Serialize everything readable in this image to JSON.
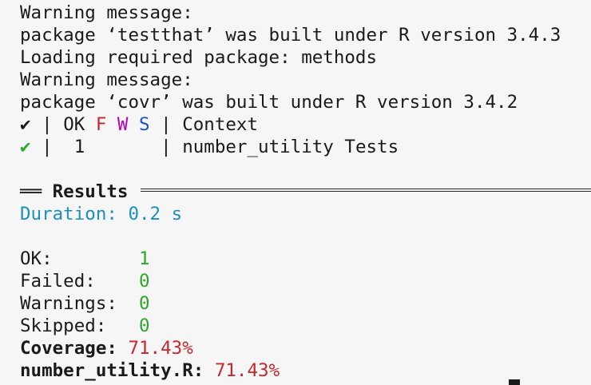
{
  "lines": {
    "warn1_label": "Warning message:",
    "warn1_text": "package ‘testthat’ was built under R version 3.4.3",
    "loading": "Loading required package: methods",
    "warn2_label": "Warning message:",
    "warn2_text": "package ‘covr’ was built under R version 3.4.2"
  },
  "table": {
    "check": "✔",
    "sep": "|",
    "ok": "OK",
    "f": "F",
    "w": "W",
    "s": "S",
    "context": "Context",
    "row_count": "1",
    "row_context": "number_utility Tests"
  },
  "results": {
    "heading": "Results",
    "rule_prefix": "══",
    "duration_label": "Duration:",
    "duration_value": "0.2 s"
  },
  "summary": {
    "ok_label": "OK:",
    "ok_value": "1",
    "failed_label": "Failed:",
    "failed_value": "0",
    "warnings_label": "Warnings:",
    "warnings_value": "0",
    "skipped_label": "Skipped:",
    "skipped_value": "0",
    "coverage_label": "Coverage:",
    "coverage_value": "71.43%",
    "file_label": "number_utility.R:",
    "file_value": "71.43%"
  },
  "colors": {
    "background": "#f6f6f6",
    "text": "#1a1a1a",
    "red": "#c5282f",
    "magenta": "#b800b8",
    "blue": "#1a4fc4",
    "green": "#29a829",
    "cyan": "#1b8fbe"
  }
}
